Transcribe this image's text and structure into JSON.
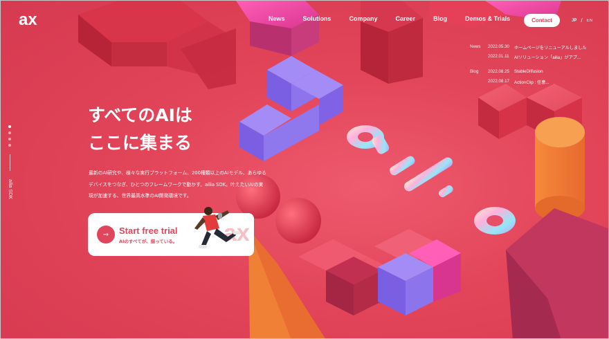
{
  "brand": {
    "logo_text": "ax"
  },
  "nav": {
    "items": [
      "News",
      "Solutions",
      "Company",
      "Career",
      "Blog",
      "Demos & Trials"
    ],
    "contact_label": "Contact",
    "lang": {
      "jp": "JP",
      "separator": "/",
      "en": "EN"
    }
  },
  "news_panel": {
    "rows": [
      {
        "category": "News",
        "date": "2022.05.30",
        "title": "ホームページをリニューアルしました"
      },
      {
        "category": "",
        "date": "2022.01.11",
        "title": "AIソリューション「ailia」がアプ..."
      },
      {
        "category": "Blog",
        "date": "2022.08.25",
        "title": "StableDiffusion"
      },
      {
        "category": "",
        "date": "2022.08.17",
        "title": "ActionClip : 任意..."
      }
    ]
  },
  "side": {
    "vertical_label": "ailia SDK"
  },
  "hero": {
    "headline_line1": "すべてのAIは",
    "headline_line2": "ここに集まる",
    "description_line1": "最新のAI研究や、様々な実行プラットフォーム、200種類以上のAIモデル、あらゆる",
    "description_line2": "デバイスをつなぎ、ひとつのフレームワークで動かす。ailia SDK。叶えたいAIの実",
    "description_line3": "現が加速する、世界最高水準のAI開発環境です。"
  },
  "trial": {
    "title": "Start free trial",
    "subtitle": "AIのすべてが、揃っている。",
    "arrow_glyph": "→"
  },
  "colors": {
    "accent": "#e2405a",
    "background": "#e3405a",
    "white": "#ffffff"
  }
}
